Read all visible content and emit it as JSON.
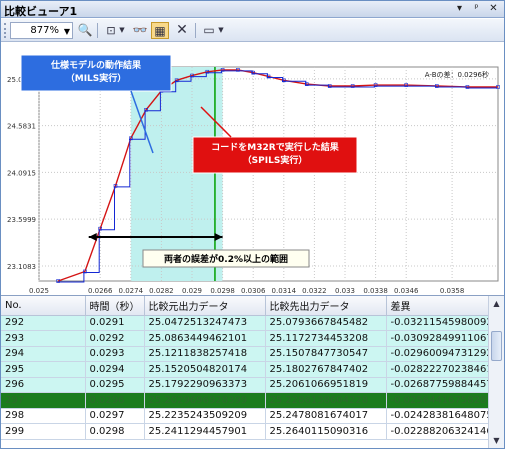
{
  "window": {
    "title": "比較ビューア1",
    "pin_glyph": "▾",
    "dock_glyph": "ᵖ",
    "close_glyph": "✕"
  },
  "toolbar": {
    "zoom": "877%"
  },
  "chart": {
    "delta_label": "A-Bの差：0.0296秒",
    "callout_mils": "仕様モデルの動作結果\n（MILS実行）",
    "callout_spils": "コードをM32Rで実行した結果\n（SPILS実行）",
    "callout_range": "両者の誤差が0.2%以上の範囲",
    "colors": {
      "series_a": "#1428d4",
      "series_b": "#d41414",
      "highlight": "#bff0ee",
      "marker": "#00a000"
    }
  },
  "chart_data": {
    "type": "line",
    "xlabel": "",
    "ylabel": "",
    "xlim": [
      0.025,
      0.037
    ],
    "ylim": [
      22.95,
      25.2
    ],
    "x_ticks": [
      "0.025",
      "0.0266",
      "0.0274",
      "0.0282",
      "0.029",
      "0.0298",
      "0.0306",
      "0.0314",
      "0.0322",
      "0.033",
      "0.0338",
      "0.0346",
      "0.0358"
    ],
    "y_ticks": [
      "25.0746",
      "24.5831",
      "24.0915",
      "23.5999",
      "23.1083"
    ],
    "highlight_x": [
      0.0274,
      0.0298
    ],
    "marker_x": 0.0296,
    "series": [
      {
        "name": "",
        "x": [
          0.0255,
          0.0262,
          0.0266,
          0.027,
          0.0274,
          0.0278,
          0.0282,
          0.0286,
          0.029,
          0.0294,
          0.0298,
          0.0302,
          0.0306,
          0.031,
          0.0314,
          0.032,
          0.0326,
          0.0332,
          0.0338,
          0.0346,
          0.0354,
          0.0362,
          0.037
        ],
        "y": [
          22.95,
          23.05,
          23.5,
          23.95,
          24.45,
          24.75,
          24.95,
          25.06,
          25.11,
          25.15,
          25.17,
          25.17,
          25.14,
          25.1,
          25.06,
          25.02,
          25.0,
          25.0,
          25.01,
          25.01,
          25.0,
          24.99,
          24.99
        ]
      }
    ]
  },
  "table": {
    "headers": [
      "No.",
      "時間（秒）",
      "比較元出力データ",
      "比較先出力データ",
      "差異"
    ],
    "rows": [
      [
        "292",
        "0.0291",
        "25.0472513247473",
        "25.0793667845482",
        "-0.0321154598009201"
      ],
      [
        "293",
        "0.0292",
        "25.0863449462101",
        "25.1172734453208",
        "-0.0309284991106757"
      ],
      [
        "294",
        "0.0293",
        "25.1211838257418",
        "25.1507847730547",
        "-0.0296009473129253"
      ],
      [
        "295",
        "0.0294",
        "25.1520504820174",
        "25.1802767847402",
        "-0.0282227023846175"
      ],
      [
        "296",
        "0.0295",
        "25.1792290963373",
        "25.2061066951819",
        "-0.0268775988445746"
      ],
      [
        "297",
        "0.0296",
        "25.2029696928399",
        "25.2286138604228",
        "-0.0256441675828718"
      ],
      [
        "298",
        "0.0297",
        "25.2235243509209",
        "25.2478081674017",
        "-0.0242838164807502"
      ],
      [
        "299",
        "0.0298",
        "25.2411294457901",
        "25.2640115090316",
        "-0.0228820632414681"
      ]
    ]
  }
}
